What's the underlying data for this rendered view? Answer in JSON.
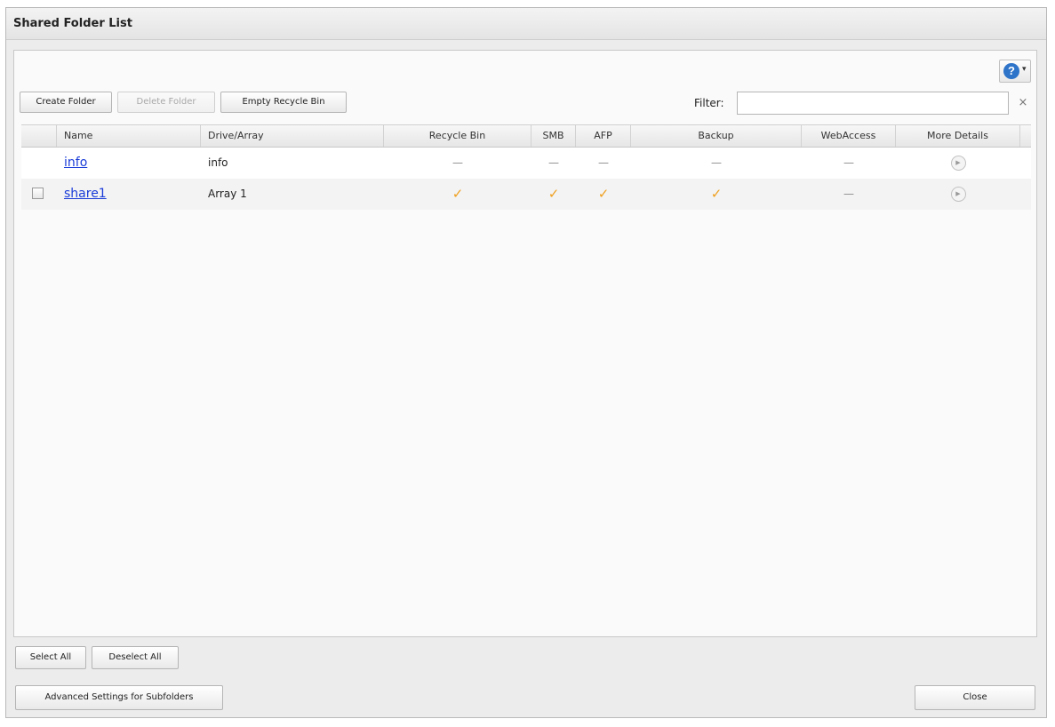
{
  "dialog": {
    "title": "Shared Folder List"
  },
  "help": {
    "icon": "help-icon",
    "label": "?",
    "arrow": "▾"
  },
  "toolbar": {
    "create_label": "Create Folder",
    "delete_label": "Delete Folder",
    "empty_recycle_label": "Empty Recycle Bin",
    "filter_label": "Filter:",
    "filter_value": "",
    "filter_clear": "×"
  },
  "table": {
    "columns": [
      "",
      "Name",
      "Drive/Array",
      "Recycle Bin",
      "SMB",
      "AFP",
      "Backup",
      "WebAccess",
      "More Details"
    ],
    "rows": [
      {
        "name": "info",
        "drive": "info",
        "recycle": "—",
        "smb": "—",
        "afp": "—",
        "backup": "—",
        "webaccess": "—",
        "details": "▶",
        "has_checkbox": false
      },
      {
        "name": "share1",
        "drive": "Array 1",
        "recycle": "✓",
        "smb": "✓",
        "afp": "✓",
        "backup": "✓",
        "webaccess": "—",
        "details": "▶",
        "has_checkbox": true
      }
    ]
  },
  "footer": {
    "select_all_label": "Select All",
    "deselect_all_label": "Deselect All",
    "advanced_label": "Advanced Settings for Subfolders",
    "close_label": "Close"
  },
  "colors": {
    "check": "#f0a020",
    "link": "#1a3cd8",
    "help": "#2e74c9"
  }
}
